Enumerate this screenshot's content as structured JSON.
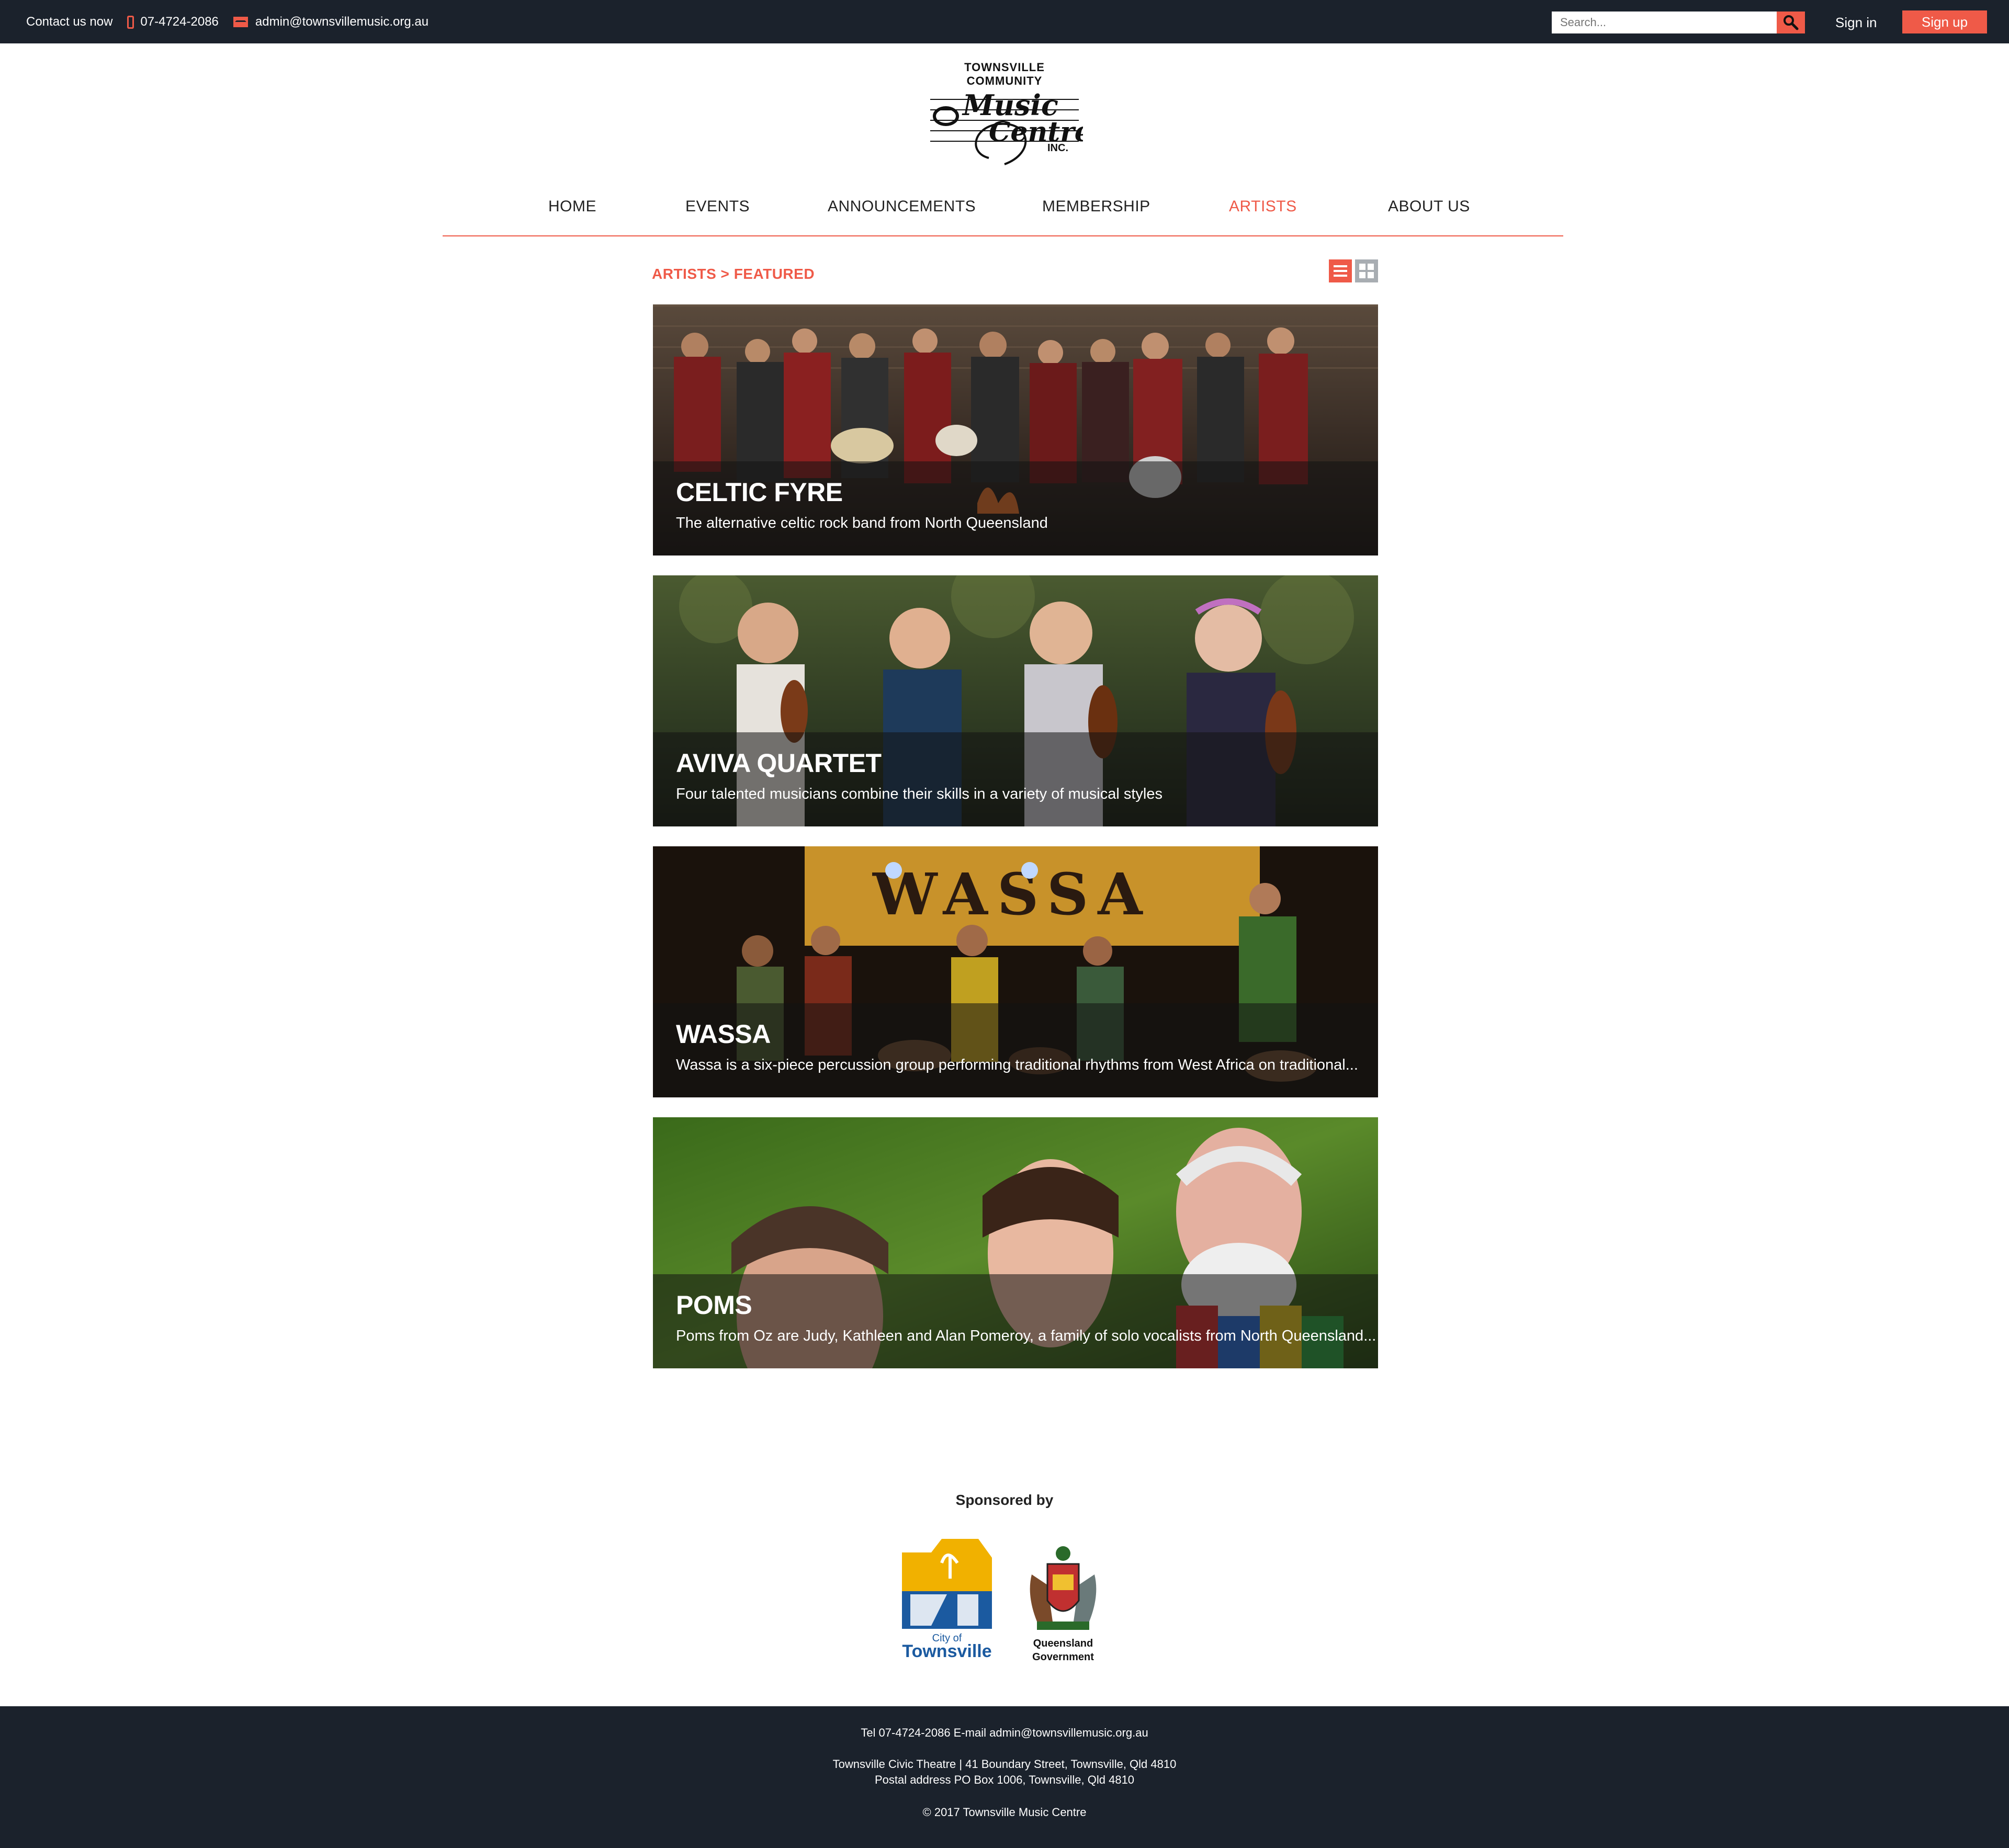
{
  "topbar": {
    "contact_label": "Contact us now",
    "phone": "07-4724-2086",
    "email": "admin@townsvillemusic.org.au",
    "search_placeholder": "Search...",
    "signin_label": "Sign in",
    "signup_label": "Sign up"
  },
  "logo": {
    "top_text": "TOWNSVILLE COMMUNITY",
    "main_text": "Music Centre",
    "suffix": "INC."
  },
  "nav": {
    "items": [
      {
        "label": "HOME"
      },
      {
        "label": "EVENTS"
      },
      {
        "label": "ANNOUNCEMENTS"
      },
      {
        "label": "MEMBERSHIP"
      },
      {
        "label": "ARTISTS",
        "active": true
      },
      {
        "label": "ABOUT US"
      }
    ]
  },
  "breadcrumb": "ARTISTS > FEATURED",
  "view_toggle": {
    "list": "list-icon",
    "grid": "grid-icon",
    "active": "list"
  },
  "artists": [
    {
      "name": "CELTIC FYRE",
      "description": "The alternative celtic rock band from North Queensland"
    },
    {
      "name": "AVIVA QUARTET",
      "description": "Four talented musicians combine their skills in a variety of musical styles"
    },
    {
      "name": "WASSA",
      "description": "Wassa is a six-piece percussion group performing traditional rhythms from West Africa on traditional..."
    },
    {
      "name": "POMS",
      "description": "Poms from Oz are Judy, Kathleen and Alan Pomeroy, a family of solo vocalists from North Queensland..."
    }
  ],
  "sponsors": {
    "heading": "Sponsored by",
    "items": [
      {
        "line1": "City of",
        "line2": "Townsville"
      },
      {
        "line1": "Queensland",
        "line2": "Government"
      }
    ]
  },
  "footer": {
    "contact_line": "Tel  07-4724-2086  E-mail  admin@townsvillemusic.org.au",
    "address_line": "Townsville Civic Theatre   |   41 Boundary Street, Townsville, Qld 4810",
    "postal_line": "Postal address   PO Box 1006, Townsville, Qld 4810",
    "copyright": "© 2017 Townsville Music Centre"
  },
  "colors": {
    "accent": "#ef5a48",
    "dark": "#1b222c",
    "muted": "#a8adb2"
  }
}
